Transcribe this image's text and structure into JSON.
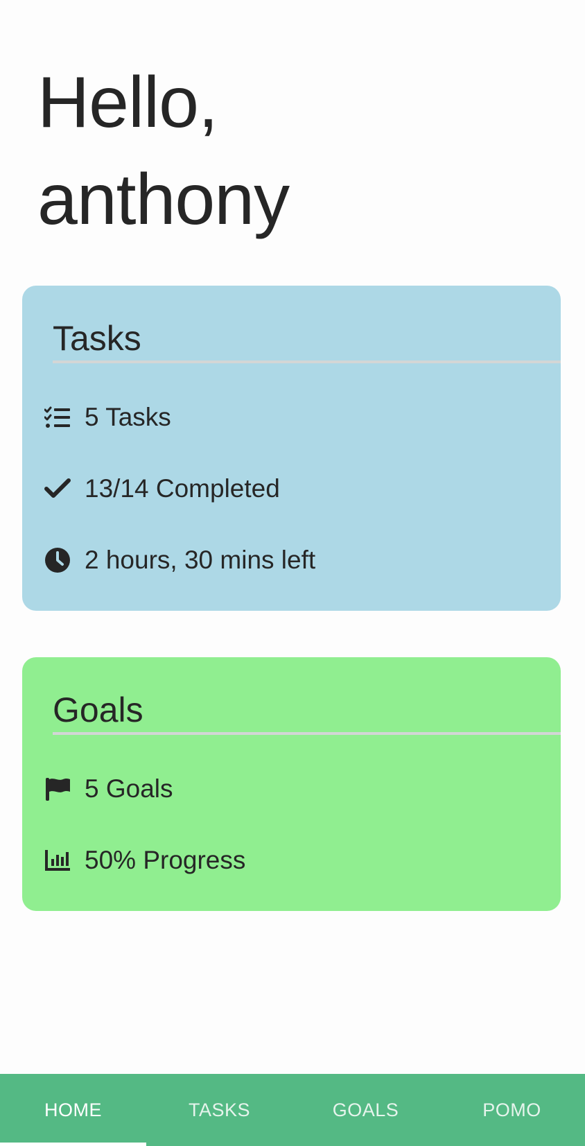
{
  "colors": {
    "background": "#fdfdfd",
    "tasks_card": "#add8e6",
    "goals_card": "#90ee90",
    "nav_bar": "#54b984",
    "nav_active_text": "#ffffff",
    "nav_inactive_text": "#e6f4ec",
    "text": "#262626"
  },
  "greeting": {
    "line1": "Hello,",
    "line2": "anthony"
  },
  "tasks_card": {
    "title": "Tasks",
    "rows": [
      {
        "icon": "task-list-icon",
        "text": "5 Tasks"
      },
      {
        "icon": "check-icon",
        "text": "13/14 Completed"
      },
      {
        "icon": "clock-icon",
        "text": "2 hours, 30 mins left"
      }
    ]
  },
  "goals_card": {
    "title": "Goals",
    "rows": [
      {
        "icon": "flag-icon",
        "text": "5 Goals"
      },
      {
        "icon": "bar-chart-icon",
        "text": "50% Progress"
      }
    ]
  },
  "nav": {
    "active": "HOME",
    "tabs": [
      {
        "label": "HOME"
      },
      {
        "label": "TASKS"
      },
      {
        "label": "GOALS"
      },
      {
        "label": "POMO"
      }
    ]
  }
}
